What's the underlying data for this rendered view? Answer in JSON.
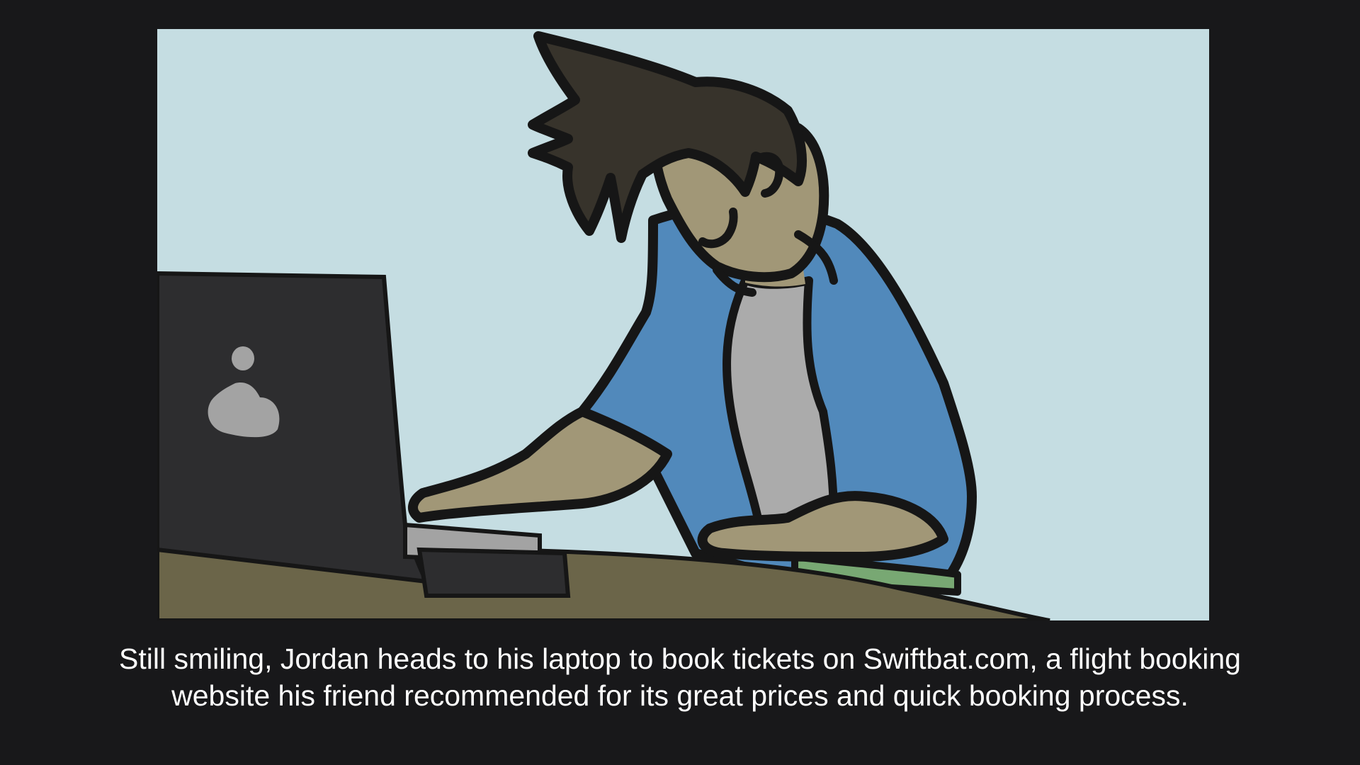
{
  "caption": "Still smiling, Jordan heads to his laptop to book tickets on Swiftbat.com, a flight booking website his friend recommended for its great prices and quick booking process.",
  "colors": {
    "frame": "#18181a",
    "sky": "#c5dde2",
    "desk": "#6b6549",
    "laptop": "#2d2d2f",
    "laptop_logo": "#a3a3a3",
    "skin": "#a19777",
    "hair": "#37332b",
    "jacket": "#5189bb",
    "shirt": "#ababab",
    "pants": "#78a873",
    "outline": "#161616",
    "caption_text": "#ffffff"
  }
}
